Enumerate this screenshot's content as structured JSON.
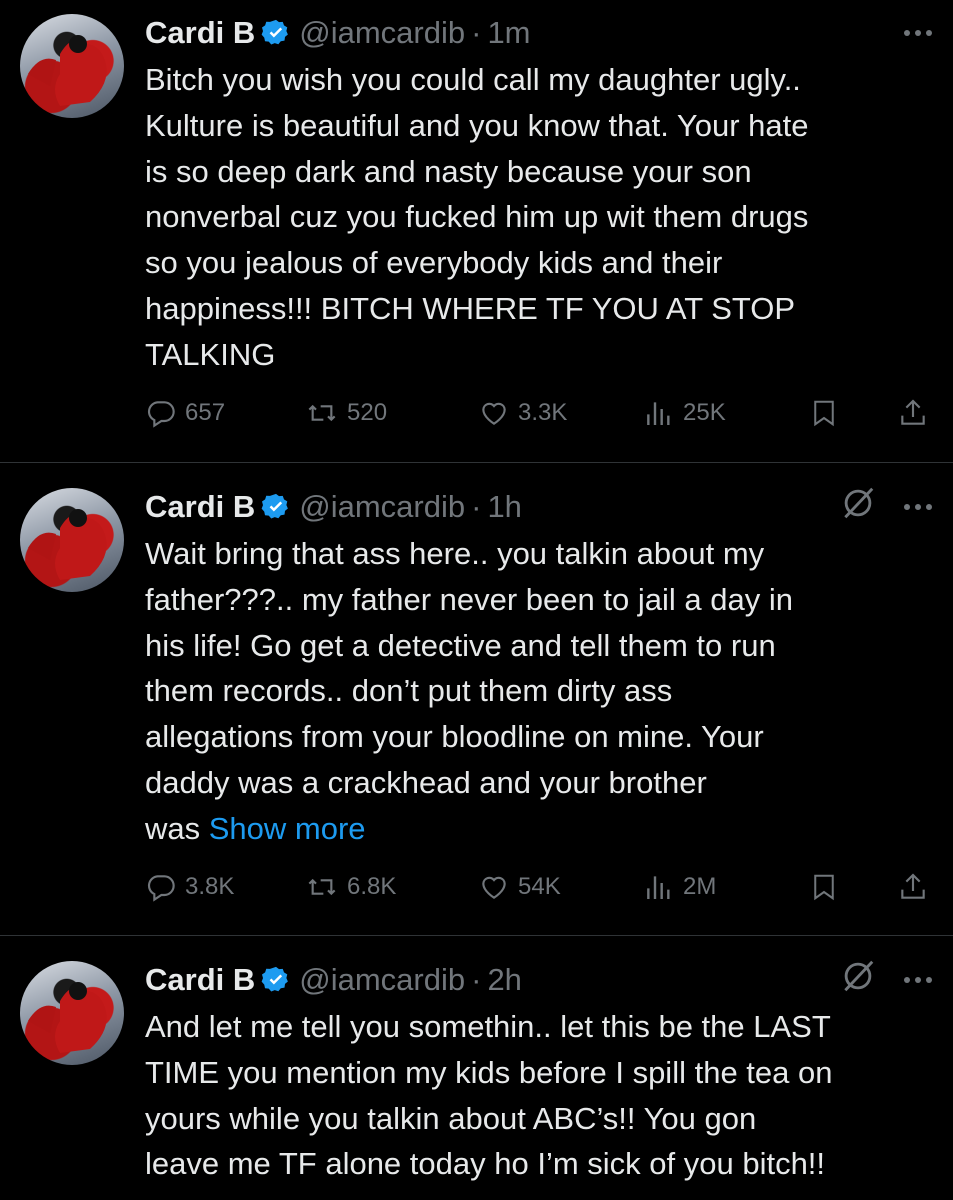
{
  "colors": {
    "background": "#000000",
    "text": "#e7e9ea",
    "muted": "#71767b",
    "link": "#1d9bf0",
    "verified": "#1d9bf0"
  },
  "tweets": [
    {
      "name": "Cardi B",
      "handle": "@iamcardib",
      "separator": "·",
      "time": "1m",
      "grok_icon": false,
      "lines": [
        "Bitch you wish you could call my daughter ugly..",
        "Kulture is beautiful and you know that. Your hate",
        "is so deep dark and nasty because your son",
        "nonverbal cuz you fucked him up wit them drugs",
        "so you jealous of everybody kids and their",
        "happiness!!! BITCH WHERE TF YOU AT STOP",
        "TALKING"
      ],
      "replies": "657",
      "reposts": "520",
      "likes": "3.3K",
      "views": "25K"
    },
    {
      "name": "Cardi B",
      "handle": "@iamcardib",
      "separator": "·",
      "time": "1h",
      "grok_icon": true,
      "lines": [
        "Wait bring that ass here.. you talkin about my",
        "father???.. my father never been to jail a day in",
        "his life! Go get a detective and tell them to run",
        "them records.. don’t put them dirty ass",
        "allegations from your bloodline on mine. Your",
        "daddy was a crackhead and your brother"
      ],
      "last_line_prefix": "was ",
      "show_more": "Show more",
      "replies": "3.8K",
      "reposts": "6.8K",
      "likes": "54K",
      "views": "2M"
    },
    {
      "name": "Cardi B",
      "handle": "@iamcardib",
      "separator": "·",
      "time": "2h",
      "grok_icon": true,
      "lines": [
        "And let me tell you somethin.. let this be the LAST",
        "TIME you mention my kids before I spill the tea on",
        "yours while you talkin about ABC’s!! You gon",
        "leave me TF alone today ho I’m sick of you bitch!!"
      ]
    }
  ],
  "icons": {
    "verified": "verified-badge-icon",
    "more": "more-options-icon",
    "grok": "grok-icon",
    "reply": "reply-icon",
    "repost": "repost-icon",
    "like": "like-icon",
    "views": "views-icon",
    "bookmark": "bookmark-icon",
    "share": "share-icon"
  }
}
